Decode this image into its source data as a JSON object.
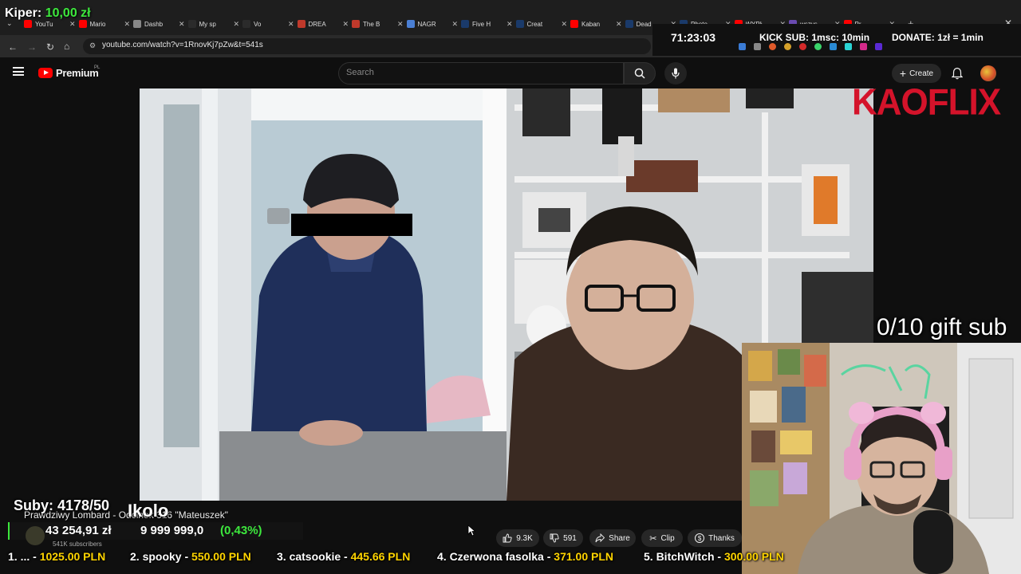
{
  "browser": {
    "tabs": [
      {
        "label": "YouTu",
        "color": "#ff0000"
      },
      {
        "label": "Mario",
        "color": "#ff0000"
      },
      {
        "label": "Dashb",
        "color": "#888888"
      },
      {
        "label": "My sp",
        "color": "#2b2b2b"
      },
      {
        "label": "Vo",
        "color": "#2b2b2b"
      },
      {
        "label": "DREA",
        "color": "#c0392b"
      },
      {
        "label": "The B",
        "color": "#c0392b"
      },
      {
        "label": "NAGR",
        "color": "#4a7fd4"
      },
      {
        "label": "Five H",
        "color": "#1a3a6a"
      },
      {
        "label": "Creat",
        "color": "#1a3a6a"
      },
      {
        "label": "Kaban",
        "color": "#ff0000"
      },
      {
        "label": "Dead",
        "color": "#1a3a6a"
      },
      {
        "label": "Photo",
        "color": "#1a3a6a"
      },
      {
        "label": "WYPŁ",
        "color": "#ff0000"
      },
      {
        "label": "wszys",
        "color": "#6a4ab0"
      },
      {
        "label": "Pr",
        "color": "#ff0000"
      }
    ],
    "url": "youtube.com/watch?v=1RnovKj7pZw&t=541s"
  },
  "stream": {
    "top_donation_name": "Kiper:",
    "top_donation_amount": "10,00 zł",
    "timer": "71:23:03",
    "kick_sub": "KICK SUB: 1msc: 10min",
    "donate": "DONATE: 1zł = 1min",
    "brand": "KAOFLIX",
    "gift_sub": "0/10 gift sub",
    "suby": "Suby: 4178/50",
    "kolo": "Ikolo",
    "goal_current": "43 254,91 zł",
    "goal_target": "9 999 999,0",
    "goal_pct": "(0,43%)",
    "goal_fraction": 0.0043,
    "ticker": [
      {
        "name": "1. ... - ",
        "value": "1025.00 PLN"
      },
      {
        "name": "2. spooky - ",
        "value": "550.00 PLN"
      },
      {
        "name": "3. catsookie - ",
        "value": "445.66 PLN"
      },
      {
        "name": "4. Czerwona fasolka - ",
        "value": "371.00 PLN"
      },
      {
        "name": "5. BitchWitch - ",
        "value": "300.00 PLN"
      }
    ]
  },
  "youtube": {
    "logo": "Premium",
    "logo_region": "PL",
    "search_placeholder": "Search",
    "create_label": "Create",
    "video_title": "Prawdziwy Lombard - Odcinek 316 \"Mateuszek\"",
    "subscribers": "541K subscribers",
    "likes": "9.3K",
    "dislikes": "591",
    "share_label": "Share",
    "clip_label": "Clip",
    "thanks_label": "Thanks"
  }
}
